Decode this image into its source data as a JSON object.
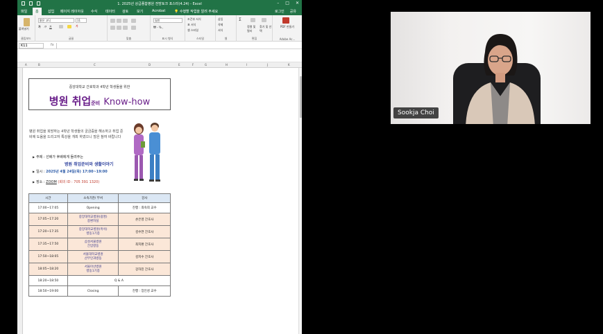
{
  "excel": {
    "window_title": "1. 2025년 상급종합병원 전망토크 포스터(4.24) - Excel",
    "tabs": [
      "파일",
      "홈",
      "삽입",
      "페이지 레이아웃",
      "수식",
      "데이터",
      "검토",
      "보기",
      "Acrobat",
      "수행할 작업을 알려 주세요"
    ],
    "tabs_right": [
      "로그인",
      "공유"
    ],
    "ribbon": {
      "paste_label": "붙여넣기",
      "font_name": "맑은 고딕",
      "font_size": "11",
      "number_format": "일반",
      "cond_format": "조건부 서식",
      "table_format": "표 서식",
      "cell_style": "셀 스타일",
      "insert": "삽입",
      "delete": "삭제",
      "format": "서식",
      "sort_filter": "정렬 및 필터",
      "find_select": "찾기 및 선택",
      "pdf": "PDF 만들기",
      "group_labels": [
        "클립보드",
        "글꼴",
        "맞춤",
        "표시 형식",
        "스타일",
        "셀",
        "편집",
        "Adobe Ac..."
      ]
    },
    "name_box": "K11",
    "fx": "fx",
    "columns": [
      "A",
      "B",
      "C",
      "D",
      "E",
      "F",
      "G",
      "H",
      "I",
      "J",
      "K"
    ]
  },
  "poster": {
    "subtitle": "중앙대학교 간호학과 4학년 학생들을 위한",
    "title_main": "병원 취업",
    "title_small": "준비",
    "title_en": "Know-how",
    "intro": "병원 취업을 희망하는 4학년 학생들의 궁금증을 해소하고 취업 준비에 도움을 드리고자 특강을 개최 하였으니 많은 참여 바랍니다",
    "topic_label": "주제 : 선배가 후배에게 들려주는",
    "topic_value": "병원 취업준비와 생활이야기",
    "date_label": "일시 : ",
    "date_value": "2025년 4월 24일(목) 17:00~19:00",
    "place_label": "장소 : ",
    "place_value": "ZOOM",
    "meeting_id": "(회의 ID : 705 391 1320)"
  },
  "schedule": {
    "headers": [
      "시간",
      "소속기관/ 부서",
      "강사"
    ],
    "rows": [
      {
        "time": "17:00~17:05",
        "org": "Opening",
        "speaker": "진행 : 최숙희 교수",
        "style": "white"
      },
      {
        "time": "17:05~17:20",
        "org": "중앙대학교병원(광명)\n중환자실",
        "speaker": "손은영 간호사",
        "style": "peach"
      },
      {
        "time": "17:20~17:35",
        "org": "중앙대학교병원(흑석)\n병동1기종",
        "speaker": "김수연 간호사",
        "style": "peach"
      },
      {
        "time": "17:35~17:50",
        "org": "삼성서울병원\n간암병동",
        "speaker": "최지환 간호사",
        "style": "peach"
      },
      {
        "time": "17:50~18:05",
        "org": "서울대학교병원\n산부인과병동",
        "speaker": "김지수 간호사",
        "style": "peach"
      },
      {
        "time": "18:05~18:20",
        "org": "서울아산병원\n병동1기종",
        "speaker": "강하진 간호사",
        "style": "peach"
      },
      {
        "time": "18:20~18:50",
        "org": "Q & A",
        "speaker": "",
        "style": "white"
      },
      {
        "time": "18:50~19:00",
        "org": "Closing",
        "speaker": "진행 : 장인성 교수",
        "style": "white"
      }
    ]
  },
  "participant": {
    "name": "Sookja Choi"
  }
}
